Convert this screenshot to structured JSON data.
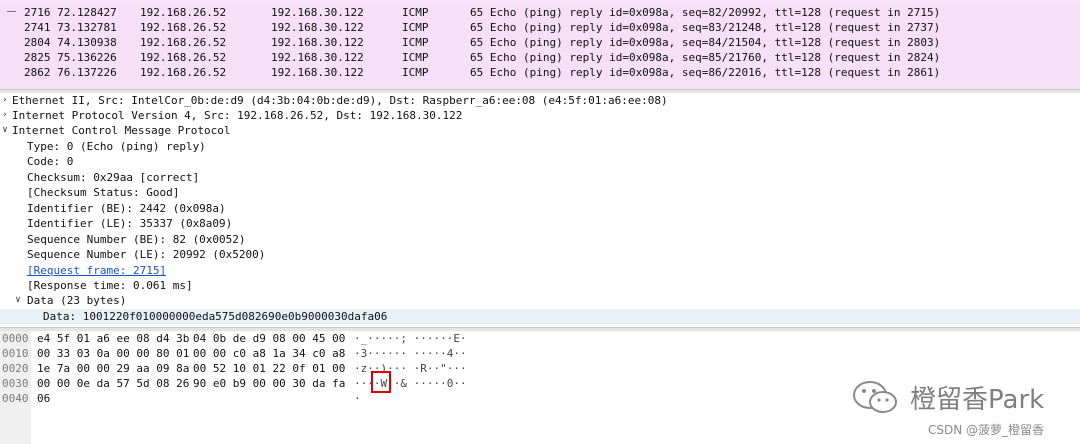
{
  "packet_list": {
    "rows": [
      {
        "no": "2716",
        "time": "72.128427",
        "src": "192.168.26.52",
        "dst": "192.168.30.122",
        "proto": "ICMP",
        "info": "65 Echo (ping) reply    id=0x098a, seq=82/20992, ttl=128 (request in 2715)"
      },
      {
        "no": "2741",
        "time": "73.132781",
        "src": "192.168.26.52",
        "dst": "192.168.30.122",
        "proto": "ICMP",
        "info": "65 Echo (ping) reply    id=0x098a, seq=83/21248, ttl=128 (request in 2737)"
      },
      {
        "no": "2804",
        "time": "74.130938",
        "src": "192.168.26.52",
        "dst": "192.168.30.122",
        "proto": "ICMP",
        "info": "65 Echo (ping) reply    id=0x098a, seq=84/21504, ttl=128 (request in 2803)"
      },
      {
        "no": "2825",
        "time": "75.136226",
        "src": "192.168.26.52",
        "dst": "192.168.30.122",
        "proto": "ICMP",
        "info": "65 Echo (ping) reply    id=0x098a, seq=85/21760, ttl=128 (request in 2824)"
      },
      {
        "no": "2862",
        "time": "76.137226",
        "src": "192.168.26.52",
        "dst": "192.168.30.122",
        "proto": "ICMP",
        "info": "65 Echo (ping) reply    id=0x098a, seq=86/22016, ttl=128 (request in 2861)"
      }
    ]
  },
  "detail": {
    "ethernet": "Ethernet II, Src: IntelCor_0b:de:d9 (d4:3b:04:0b:de:d9), Dst: Raspberr_a6:ee:08 (e4:5f:01:a6:ee:08)",
    "ip": "Internet Protocol Version 4, Src: 192.168.26.52, Dst: 192.168.30.122",
    "icmp": "Internet Control Message Protocol",
    "fields": [
      "Type: 0 (Echo (ping) reply)",
      "Code: 0",
      "Checksum: 0x29aa [correct]",
      "[Checksum Status: Good]",
      "Identifier (BE): 2442 (0x098a)",
      "Identifier (LE): 35337 (0x8a09)",
      "Sequence Number (BE): 82 (0x0052)",
      "Sequence Number (LE): 20992 (0x5200)"
    ],
    "request_frame": "[Request frame: 2715]",
    "response_time": "[Response time: 0.061 ms]",
    "data_node": "Data (23 bytes)",
    "data_value": "Data: 1001220f010000000eda575d082690e0b9000030dafa06"
  },
  "bytes": {
    "rows": [
      {
        "offset": "0000",
        "hex1": "e4 5f 01 a6 ee 08 d4 3b",
        "hex2": "04 0b de d9 08 00 45 00",
        "ascii": "·_·····; ······E·"
      },
      {
        "offset": "0010",
        "hex1": "00 33 03 0a 00 00 80 01",
        "hex2": "00 00 c0 a8 1a 34 c0 a8",
        "ascii": "·3······ ·····4··"
      },
      {
        "offset": "0020",
        "hex1": "1e 7a 00 00 29 aa 09 8a",
        "hex2": "00 52 10 01 22 0f 01 00",
        "ascii": "·z··)··· ·R··\"···"
      },
      {
        "offset": "0030",
        "hex1": "00 00 0e da 57 5d 08 26",
        "hex2": "90 e0 b9 00 00 30 da fa",
        "ascii": "····W]·& ·····0··"
      },
      {
        "offset": "0040",
        "hex1": "06",
        "hex2": "",
        "ascii": "·"
      }
    ]
  },
  "watermark": {
    "text": "橙留香Park",
    "csdn": "CSDN @菠萝_橙留香"
  }
}
